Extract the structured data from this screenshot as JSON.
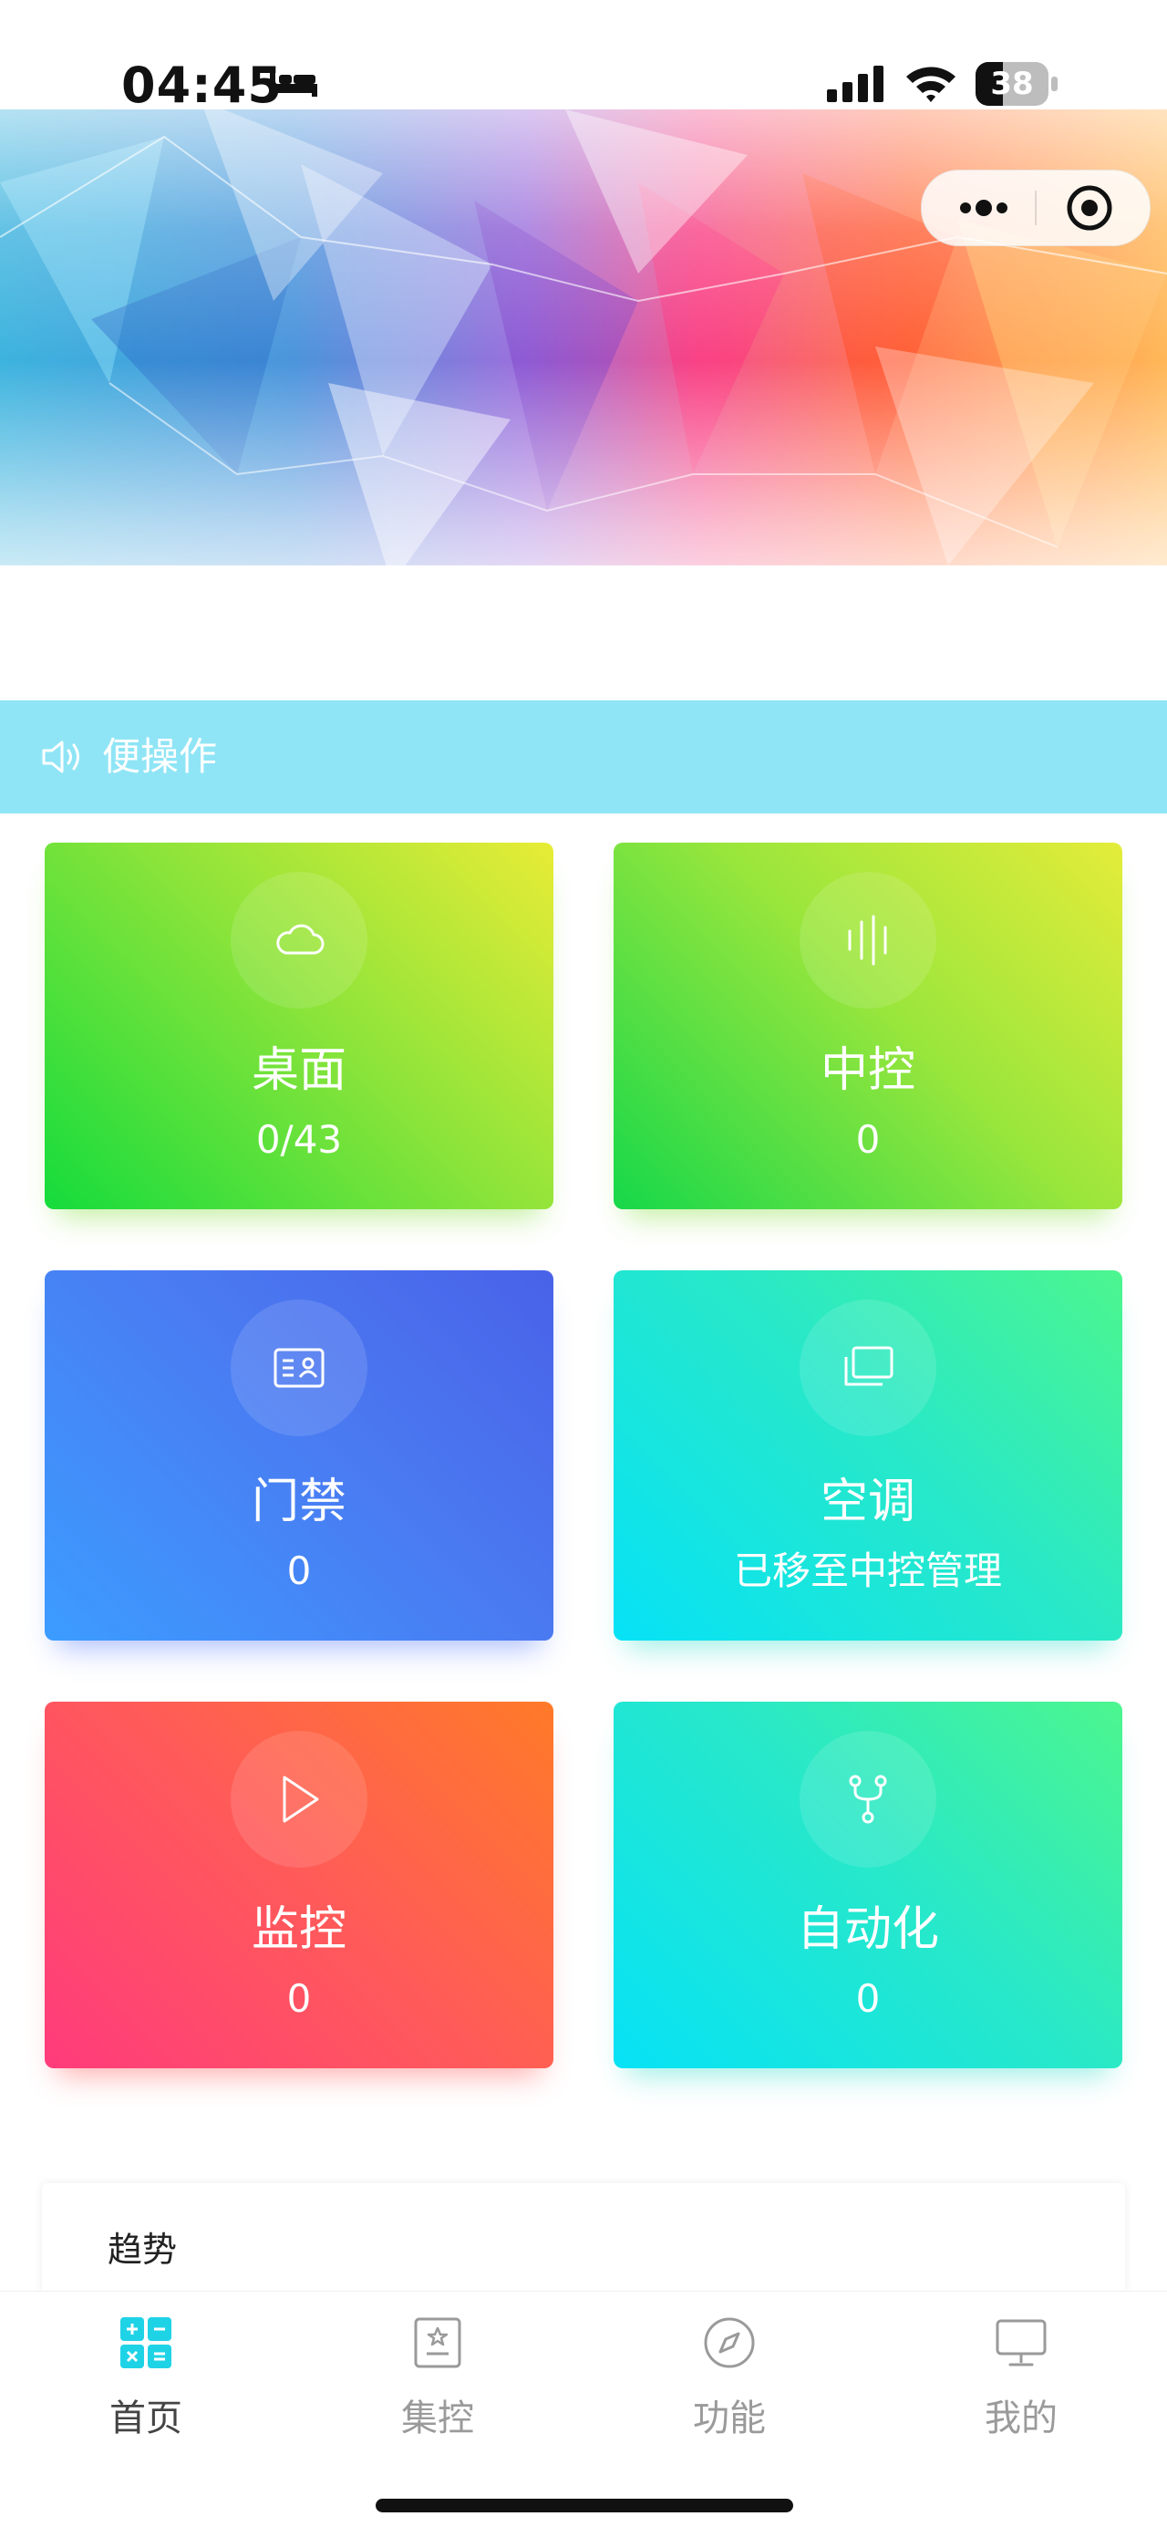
{
  "status_bar": {
    "time": "04:45",
    "battery_level": "38"
  },
  "notice": {
    "text": "便操作"
  },
  "cards": [
    {
      "title": "桌面",
      "value": "0/43"
    },
    {
      "title": "中控",
      "value": "0"
    },
    {
      "title": "门禁",
      "value": "0"
    },
    {
      "title": "空调",
      "value": "已移至中控管理"
    },
    {
      "title": "监控",
      "value": "0"
    },
    {
      "title": "自动化",
      "value": "0"
    }
  ],
  "trend": {
    "title": "趋势"
  },
  "tabbar": {
    "items": [
      {
        "label": "首页",
        "icon": "grid-calculator-icon",
        "active": true
      },
      {
        "label": "集控",
        "icon": "badge-icon",
        "active": false
      },
      {
        "label": "功能",
        "icon": "compass-icon",
        "active": false
      },
      {
        "label": "我的",
        "icon": "monitor-icon",
        "active": false
      }
    ],
    "active_color": "#1fd3e6"
  }
}
